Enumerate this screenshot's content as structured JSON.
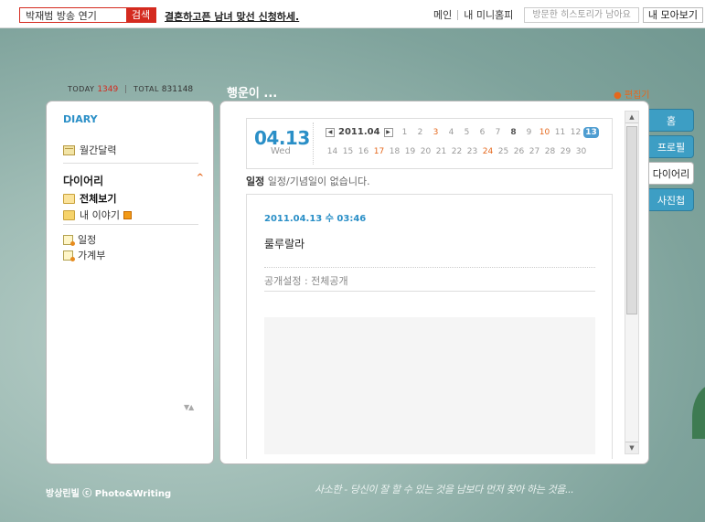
{
  "topbar": {
    "search_value": "박재범 방송 연기",
    "search_button": "검색",
    "promo_text": "결혼하고픈 남녀 맞선 신청하세.",
    "nav": [
      "메인",
      "내 미니홈피"
    ],
    "history_button": "방문한 히스토리가 남아요",
    "moa_button": "내 모아보기"
  },
  "stats": {
    "today_label": "TODAY",
    "today_value": "1349",
    "divider": "|",
    "total_label": "TOTAL",
    "total_value": "831148"
  },
  "home_title": "행운이 ...",
  "edit_link": "● 편집기",
  "sidebar": {
    "heading": "DIARY",
    "calendar_item": "월간달력",
    "section_title": "다이어리",
    "collapse_icon": "^",
    "folders": [
      "전체보기",
      "내 이야기"
    ],
    "docs": [
      "일정",
      "가계부"
    ],
    "scroll_arrows": "▼▲"
  },
  "calendar": {
    "date": "04.13",
    "dow": "Wed",
    "month": "2011.04",
    "prev": "◀",
    "next": "▶",
    "row1": [
      {
        "d": "1",
        "c": ""
      },
      {
        "d": "2",
        "c": ""
      },
      {
        "d": "3",
        "c": "red"
      },
      {
        "d": "4",
        "c": ""
      },
      {
        "d": "5",
        "c": ""
      },
      {
        "d": "6",
        "c": ""
      },
      {
        "d": "7",
        "c": ""
      },
      {
        "d": "8",
        "c": "bold"
      },
      {
        "d": "9",
        "c": ""
      },
      {
        "d": "10",
        "c": "red"
      },
      {
        "d": "11",
        "c": ""
      },
      {
        "d": "12",
        "c": ""
      },
      {
        "d": "13",
        "c": "today"
      }
    ],
    "row2": [
      {
        "d": "14",
        "c": ""
      },
      {
        "d": "15",
        "c": ""
      },
      {
        "d": "16",
        "c": ""
      },
      {
        "d": "17",
        "c": "red"
      },
      {
        "d": "18",
        "c": ""
      },
      {
        "d": "19",
        "c": ""
      },
      {
        "d": "20",
        "c": ""
      },
      {
        "d": "21",
        "c": ""
      },
      {
        "d": "22",
        "c": ""
      },
      {
        "d": "23",
        "c": ""
      },
      {
        "d": "24",
        "c": "red"
      },
      {
        "d": "25",
        "c": ""
      },
      {
        "d": "26",
        "c": ""
      },
      {
        "d": "27",
        "c": ""
      },
      {
        "d": "28",
        "c": ""
      },
      {
        "d": "29",
        "c": ""
      },
      {
        "d": "30",
        "c": ""
      }
    ]
  },
  "schedule": {
    "label": "일정",
    "text": "일정/기념일이 없습니다."
  },
  "post": {
    "date": "2011.04.13 수 03:46",
    "title": "룰루랄라",
    "privacy": "공개설정 : 전체공개"
  },
  "tabs": [
    "홈",
    "프로필",
    "다이어리",
    "사진첩"
  ],
  "active_tab": 2,
  "footer": {
    "owner": "방상린빌 ⓒ Photo&Writing",
    "quote": "사소한 - 당신이 잘 할 수 있는 것을 남보다 먼저 찾아 하는 것을..."
  }
}
